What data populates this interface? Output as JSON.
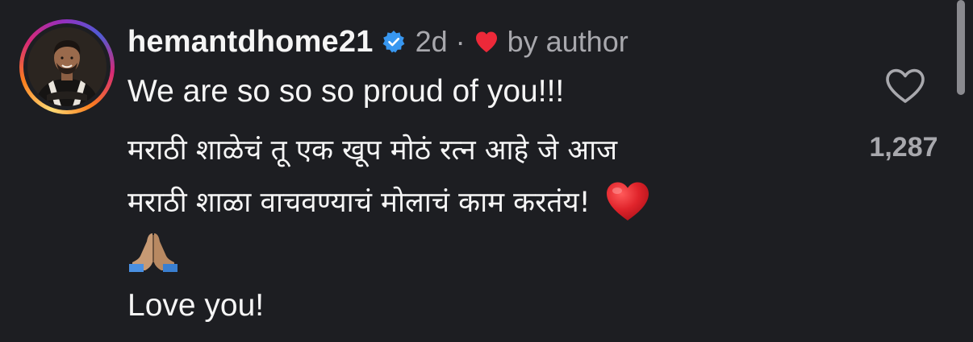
{
  "comment": {
    "username": "hemantdhome21",
    "verified": true,
    "time_ago": "2d",
    "separator": "·",
    "liked_by_author_label": "by author",
    "lines": [
      "We are so so so proud of you!!!",
      "मराठी शाळेचं तू एक खूप मोठं रत्न आहे जे आज",
      "मराठी शाळा वाचवण्याचं मोलाचं काम करतंय!",
      "Love you!"
    ],
    "emojis": {
      "line3_end": "red-heart",
      "line4": "folded-hands"
    }
  },
  "likes": {
    "count": "1,287",
    "icon": "heart-outline-icon"
  },
  "colors": {
    "background": "#1d1e22",
    "text": "#f5f5f5",
    "muted": "#a8a8ad",
    "verified_blue": "#3897f0",
    "heart_red": "#ed4956"
  }
}
